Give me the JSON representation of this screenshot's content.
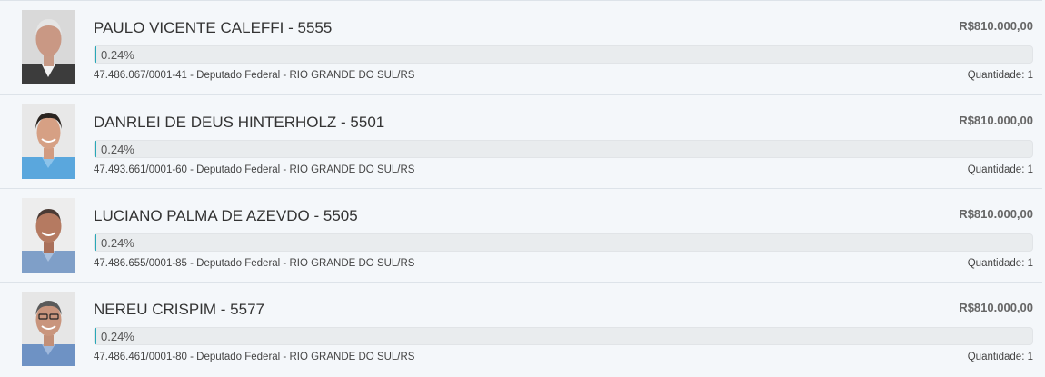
{
  "candidates": [
    {
      "name": "PAULO VICENTE CALEFFI - 5555",
      "amount": "R$810.000,00",
      "percent_label": "0.24%",
      "percent_value": 0.24,
      "details": "47.486.067/0001-41 - Deputado Federal - RIO GRANDE DO SUL/RS",
      "quantity": "Quantidade: 1"
    },
    {
      "name": "DANRLEI DE DEUS HINTERHOLZ - 5501",
      "amount": "R$810.000,00",
      "percent_label": "0.24%",
      "percent_value": 0.24,
      "details": "47.493.661/0001-60 - Deputado Federal - RIO GRANDE DO SUL/RS",
      "quantity": "Quantidade: 1"
    },
    {
      "name": "LUCIANO PALMA DE AZEVDO - 5505",
      "amount": "R$810.000,00",
      "percent_label": "0.24%",
      "percent_value": 0.24,
      "details": "47.486.655/0001-85 - Deputado Federal - RIO GRANDE DO SUL/RS",
      "quantity": "Quantidade: 1"
    },
    {
      "name": "NEREU CRISPIM - 5577",
      "amount": "R$810.000,00",
      "percent_label": "0.24%",
      "percent_value": 0.24,
      "details": "47.486.461/0001-80 - Deputado Federal - RIO GRANDE DO SUL/RS",
      "quantity": "Quantidade: 1"
    }
  ],
  "colors": {
    "bar_fill": "#28a8b8",
    "bar_track": "#e9ecee",
    "background": "#f4f7fa"
  }
}
